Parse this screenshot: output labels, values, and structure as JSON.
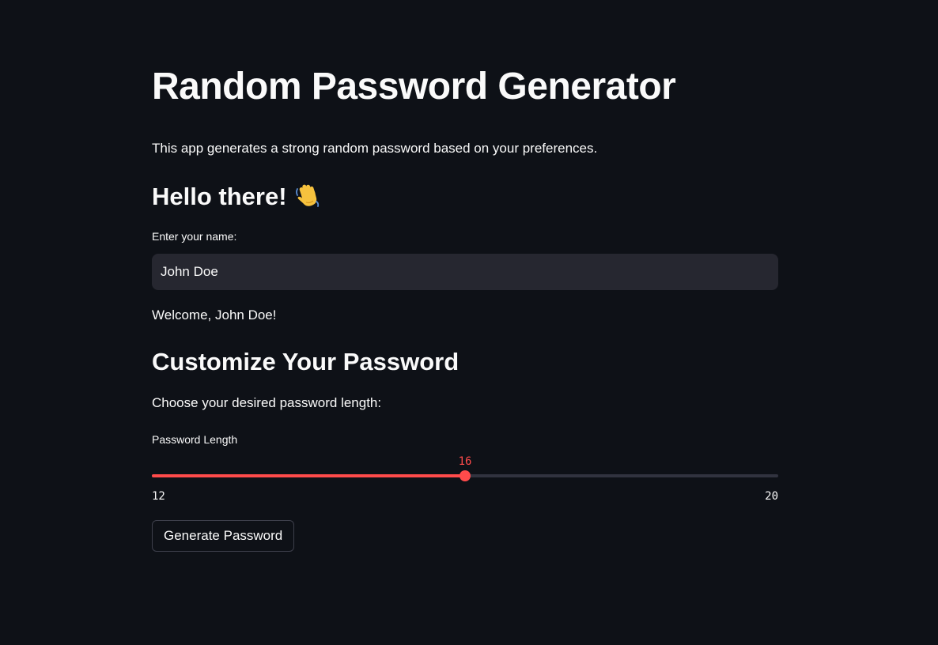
{
  "app": {
    "title": "Random Password Generator",
    "intro": "This app generates a strong random password based on your preferences."
  },
  "greeting": {
    "text": "Hello there!",
    "icon": "waving-hand-icon"
  },
  "name_input": {
    "label": "Enter your name:",
    "value": "John Doe"
  },
  "welcome": {
    "text": "Welcome, John Doe!"
  },
  "customize": {
    "heading": "Customize Your Password",
    "prompt": "Choose your desired password length:"
  },
  "length_slider": {
    "label": "Password Length",
    "value": 16,
    "min": 12,
    "max": 20,
    "min_label": "12",
    "max_label": "20",
    "value_label": "16"
  },
  "generate_button": {
    "label": "Generate Password"
  },
  "colors": {
    "background": "#0e1117",
    "accent": "#ff4b4b",
    "input_bg": "#262730",
    "text": "#fafafa"
  }
}
